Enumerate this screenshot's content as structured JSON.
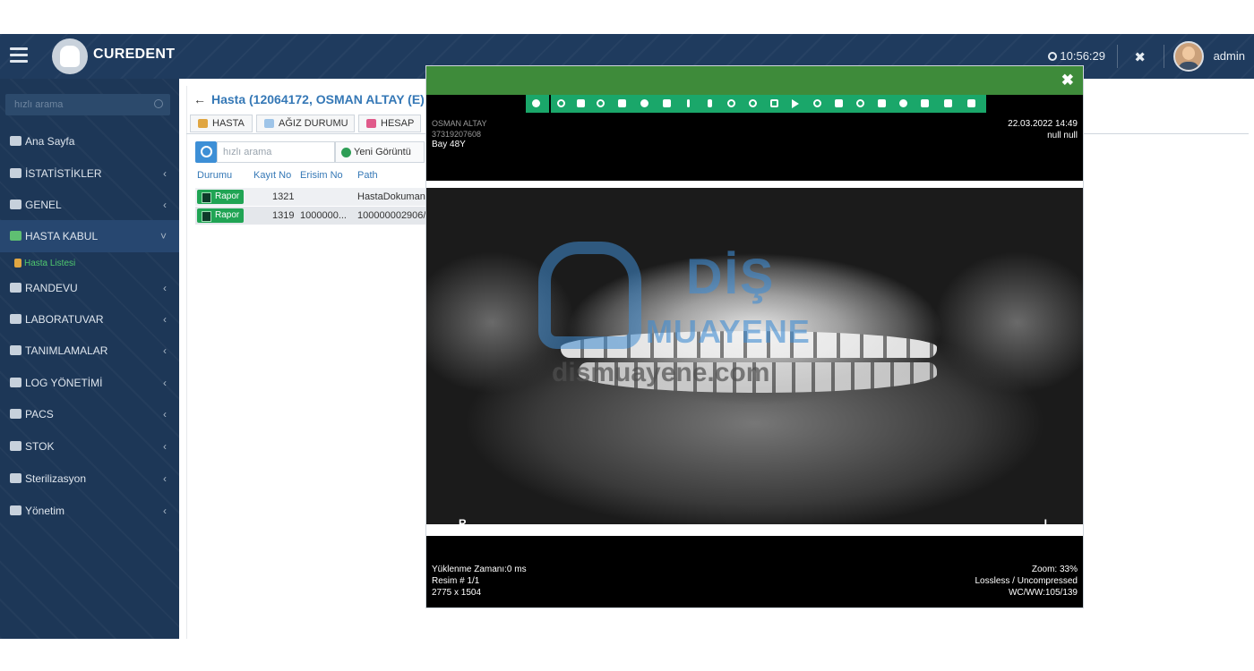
{
  "brand": {
    "name": "CUREDENT"
  },
  "header": {
    "time": "10:56:29",
    "user": "admin"
  },
  "sidebar": {
    "search_placeholder": "hızlı arama",
    "items": [
      {
        "label": "Ana Sayfa",
        "icon": "dashboard-icon",
        "has_chevron": false
      },
      {
        "label": "İSTATİSTİKLER",
        "icon": "chart-icon",
        "has_chevron": true
      },
      {
        "label": "GENEL",
        "icon": "tooth-icon",
        "has_chevron": true
      },
      {
        "label": "HASTA KABUL",
        "icon": "patient-icon",
        "has_chevron": true
      },
      {
        "label": "RANDEVU",
        "icon": "calendar-icon",
        "has_chevron": true
      },
      {
        "label": "LABORATUVAR",
        "icon": "lab-icon",
        "has_chevron": true
      },
      {
        "label": "TANIMLAMALAR",
        "icon": "diamond-icon",
        "has_chevron": true
      },
      {
        "label": "LOG YÖNETİMİ",
        "icon": "diamond-icon",
        "has_chevron": true
      },
      {
        "label": "PACS",
        "icon": "image-icon",
        "has_chevron": true
      },
      {
        "label": "STOK",
        "icon": "box-icon",
        "has_chevron": true
      },
      {
        "label": "Sterilizasyon",
        "icon": "spray-icon",
        "has_chevron": true
      },
      {
        "label": "Yönetim",
        "icon": "monitor-icon",
        "has_chevron": true
      }
    ],
    "subitem": "Hasta Listesi"
  },
  "main": {
    "title": "Hasta (12064172, OSMAN ALTAY (E) (",
    "tabs": [
      {
        "label": "HASTA",
        "icon": "patient-icon",
        "color": "#e0a642"
      },
      {
        "label": "AĞIZ DURUMU",
        "icon": "tooth-icon",
        "color": "#9ec4e8"
      },
      {
        "label": "HESAP",
        "icon": "wallet-icon",
        "color": "#e05a8a"
      }
    ],
    "search_placeholder": "hızlı arama",
    "new_image_label": "Yeni Görüntü",
    "columns": [
      "Durumu",
      "Kayıt No",
      "Erisim No",
      "Path"
    ],
    "rows": [
      {
        "status": "Rapor",
        "kayit_no": "1321",
        "erisim_no": "",
        "path": "HastaDokuman"
      },
      {
        "status": "Rapor",
        "kayit_no": "1319",
        "erisim_no": "1000000...",
        "path": "100000002906/"
      }
    ]
  },
  "viewer": {
    "top_right_date": "22.03.2022 14:49",
    "top_right_sub": "null null",
    "top_left_name": "OSMAN ALTAY",
    "top_left_id": "37319207608",
    "top_left_sex_age": "Bay 48Y",
    "watermark_line1": "DİŞ",
    "watermark_line2": "MUAYENE",
    "watermark_line3": "dismuayene.com",
    "marker_right": "R",
    "marker_left": "L",
    "load_time": "Yüklenme Zamanı:0 ms",
    "image_index": "Resim # 1/1",
    "image_size": "2775 x 1504",
    "zoom": "Zoom: 33%",
    "compression": "Lossless / Uncompressed",
    "window": "WC/WW:105/139"
  },
  "colors": {
    "navbar": "#1f3b5e",
    "sidebar": "#1d3757",
    "modal_header": "#3e8b3a",
    "toolbar": "#1aa76a",
    "accent": "#3578b6",
    "success": "#20a454"
  }
}
